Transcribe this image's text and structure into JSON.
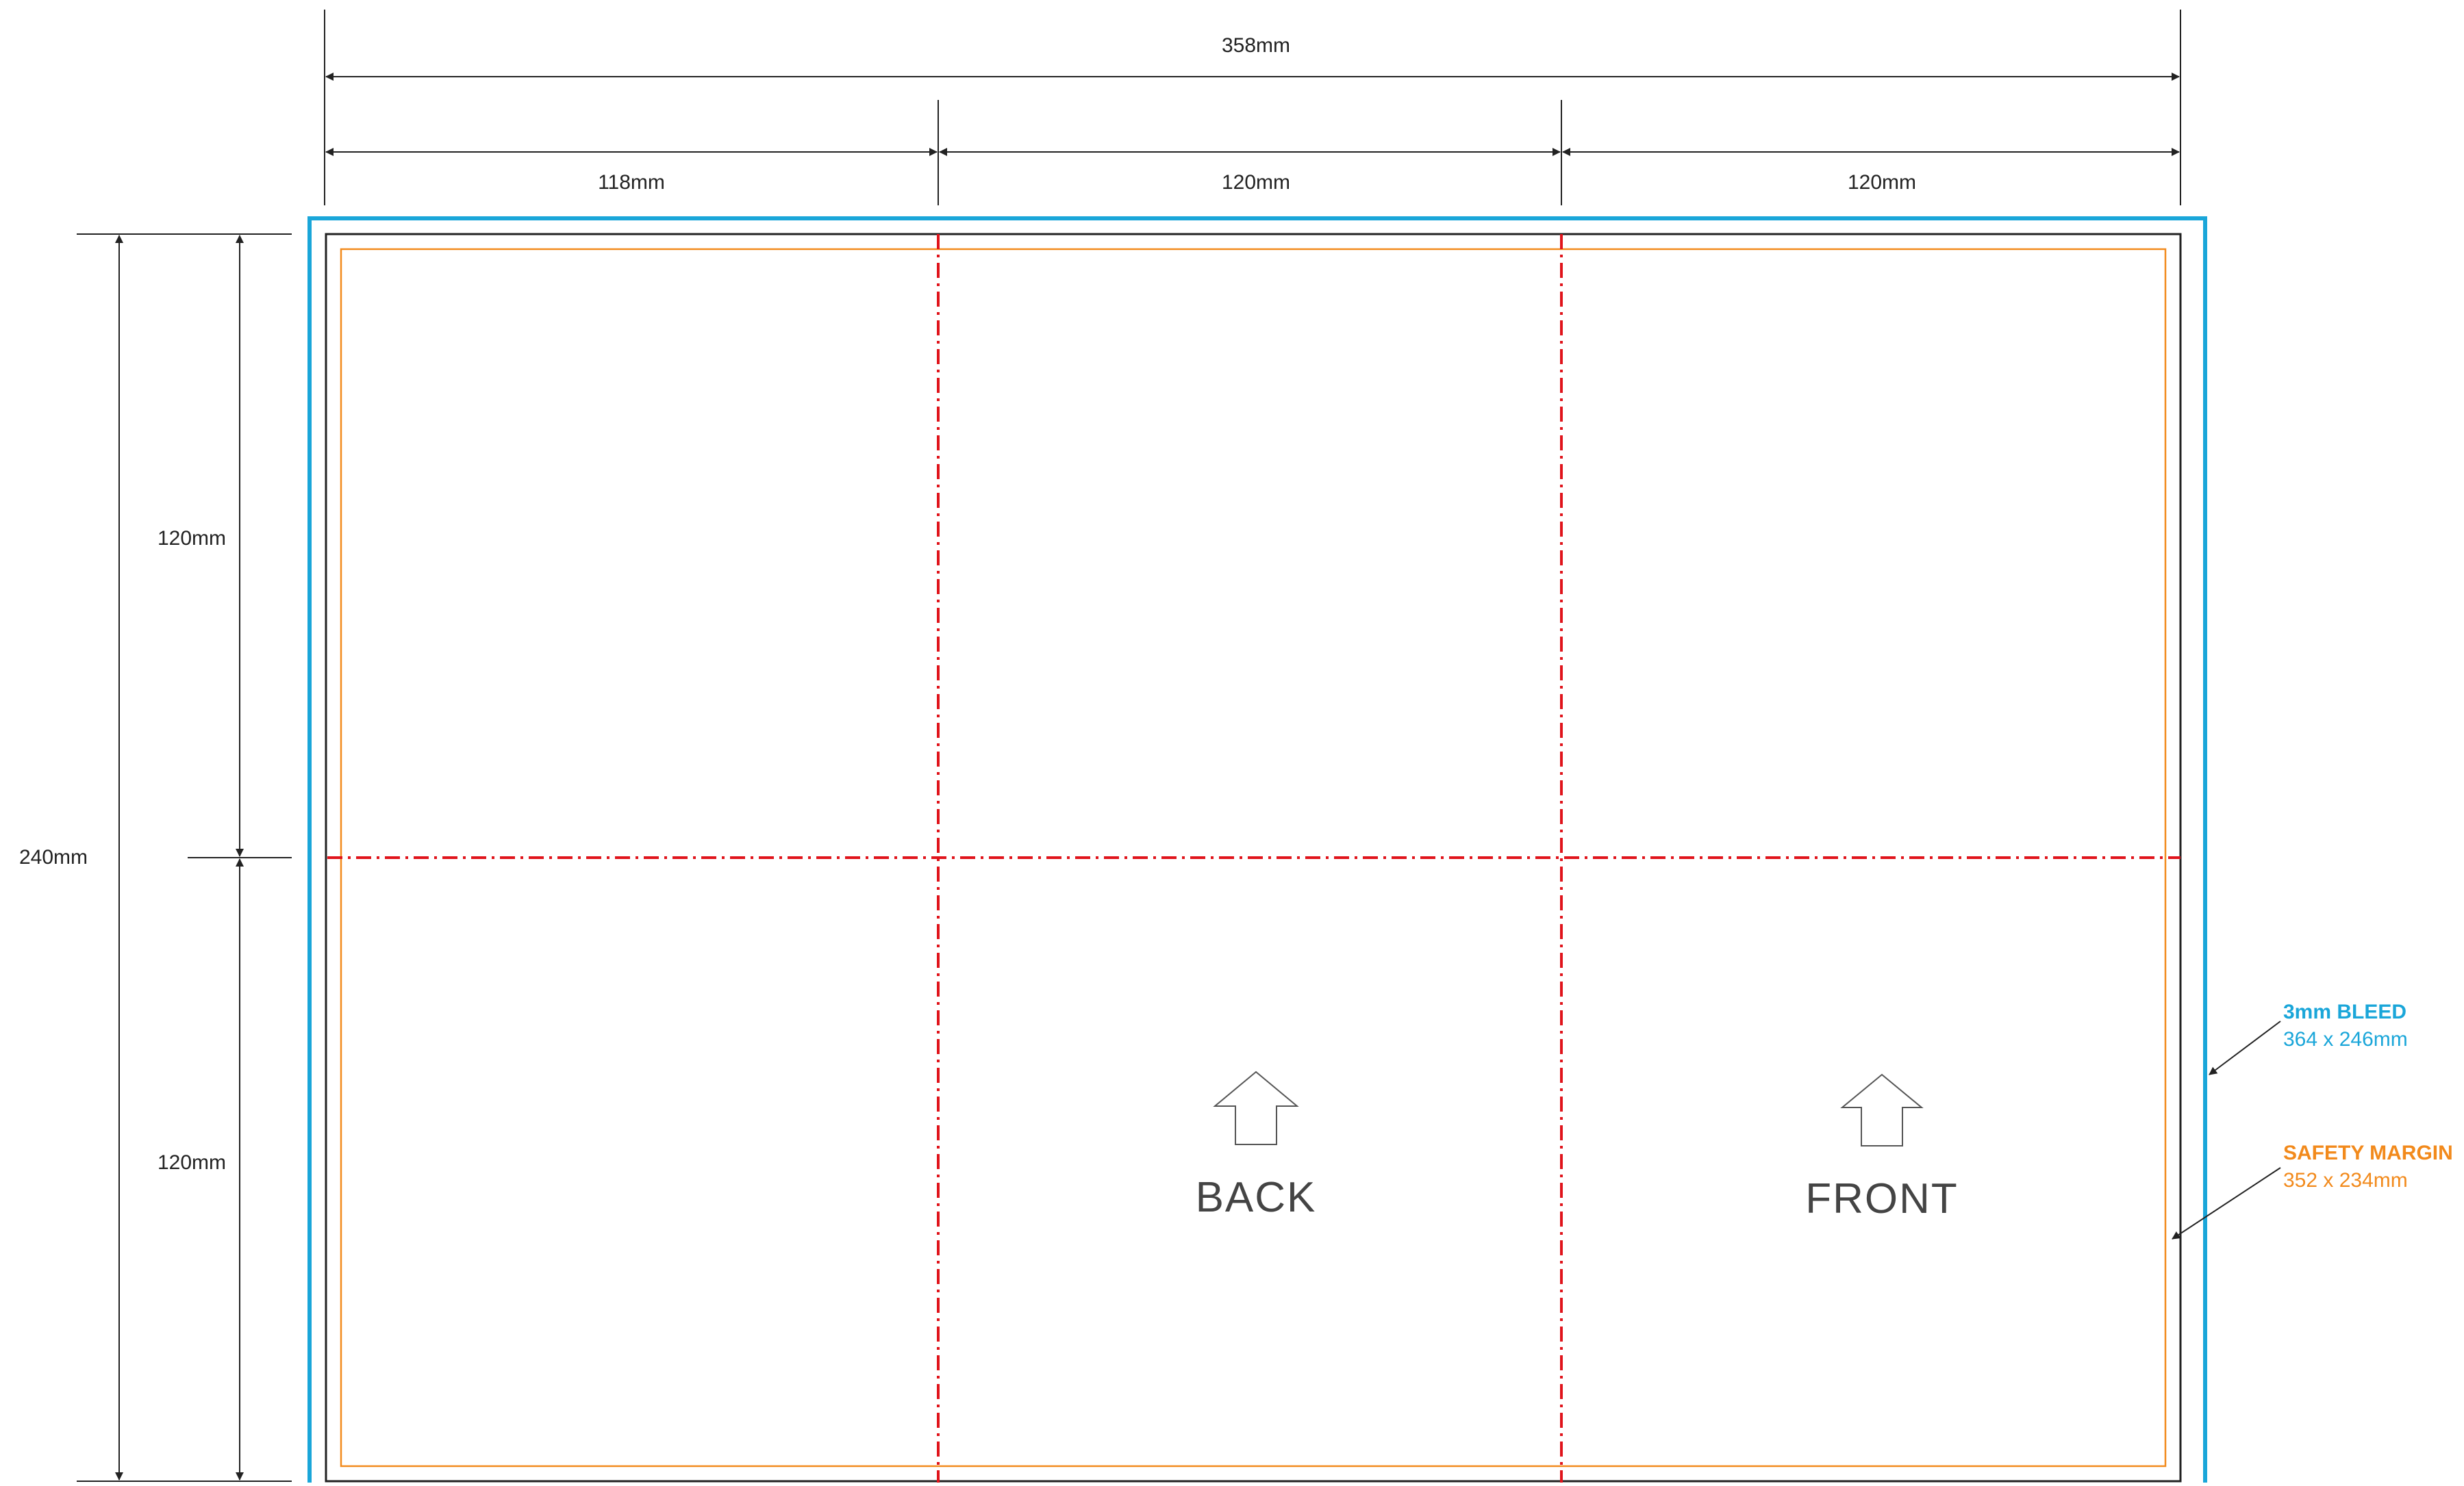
{
  "dimensions": {
    "total_width": "358mm",
    "col_1": "118mm",
    "col_2": "120mm",
    "col_3": "120mm",
    "total_height": "240mm",
    "row_1": "120mm",
    "row_2": "120mm"
  },
  "panels": {
    "back_label": "BACK",
    "front_label": "FRONT",
    "arrow_icon": "up-arrow-icon"
  },
  "callouts": {
    "bleed": {
      "title": "3mm BLEED",
      "size": "364 x 246mm"
    },
    "safety": {
      "title": "SAFETY MARGIN",
      "size": "352 x 234mm"
    }
  },
  "colors": {
    "bleed": "#1aa6d9",
    "safety": "#f28a1c",
    "fold": "#e0141b",
    "trim": "#222222",
    "dimension": "#222222"
  }
}
